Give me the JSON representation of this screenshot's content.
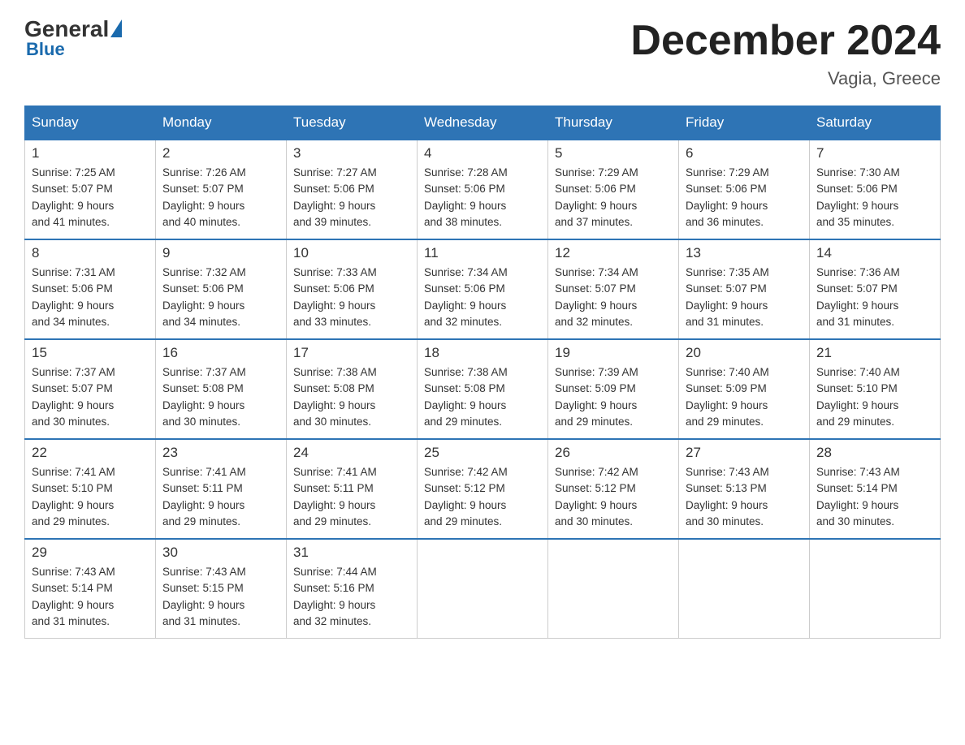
{
  "header": {
    "logo_general": "General",
    "logo_blue": "Blue",
    "month_title": "December 2024",
    "location": "Vagia, Greece"
  },
  "days_of_week": [
    "Sunday",
    "Monday",
    "Tuesday",
    "Wednesday",
    "Thursday",
    "Friday",
    "Saturday"
  ],
  "weeks": [
    [
      {
        "day": "1",
        "sunrise": "7:25 AM",
        "sunset": "5:07 PM",
        "daylight": "9 hours and 41 minutes."
      },
      {
        "day": "2",
        "sunrise": "7:26 AM",
        "sunset": "5:07 PM",
        "daylight": "9 hours and 40 minutes."
      },
      {
        "day": "3",
        "sunrise": "7:27 AM",
        "sunset": "5:06 PM",
        "daylight": "9 hours and 39 minutes."
      },
      {
        "day": "4",
        "sunrise": "7:28 AM",
        "sunset": "5:06 PM",
        "daylight": "9 hours and 38 minutes."
      },
      {
        "day": "5",
        "sunrise": "7:29 AM",
        "sunset": "5:06 PM",
        "daylight": "9 hours and 37 minutes."
      },
      {
        "day": "6",
        "sunrise": "7:29 AM",
        "sunset": "5:06 PM",
        "daylight": "9 hours and 36 minutes."
      },
      {
        "day": "7",
        "sunrise": "7:30 AM",
        "sunset": "5:06 PM",
        "daylight": "9 hours and 35 minutes."
      }
    ],
    [
      {
        "day": "8",
        "sunrise": "7:31 AM",
        "sunset": "5:06 PM",
        "daylight": "9 hours and 34 minutes."
      },
      {
        "day": "9",
        "sunrise": "7:32 AM",
        "sunset": "5:06 PM",
        "daylight": "9 hours and 34 minutes."
      },
      {
        "day": "10",
        "sunrise": "7:33 AM",
        "sunset": "5:06 PM",
        "daylight": "9 hours and 33 minutes."
      },
      {
        "day": "11",
        "sunrise": "7:34 AM",
        "sunset": "5:06 PM",
        "daylight": "9 hours and 32 minutes."
      },
      {
        "day": "12",
        "sunrise": "7:34 AM",
        "sunset": "5:07 PM",
        "daylight": "9 hours and 32 minutes."
      },
      {
        "day": "13",
        "sunrise": "7:35 AM",
        "sunset": "5:07 PM",
        "daylight": "9 hours and 31 minutes."
      },
      {
        "day": "14",
        "sunrise": "7:36 AM",
        "sunset": "5:07 PM",
        "daylight": "9 hours and 31 minutes."
      }
    ],
    [
      {
        "day": "15",
        "sunrise": "7:37 AM",
        "sunset": "5:07 PM",
        "daylight": "9 hours and 30 minutes."
      },
      {
        "day": "16",
        "sunrise": "7:37 AM",
        "sunset": "5:08 PM",
        "daylight": "9 hours and 30 minutes."
      },
      {
        "day": "17",
        "sunrise": "7:38 AM",
        "sunset": "5:08 PM",
        "daylight": "9 hours and 30 minutes."
      },
      {
        "day": "18",
        "sunrise": "7:38 AM",
        "sunset": "5:08 PM",
        "daylight": "9 hours and 29 minutes."
      },
      {
        "day": "19",
        "sunrise": "7:39 AM",
        "sunset": "5:09 PM",
        "daylight": "9 hours and 29 minutes."
      },
      {
        "day": "20",
        "sunrise": "7:40 AM",
        "sunset": "5:09 PM",
        "daylight": "9 hours and 29 minutes."
      },
      {
        "day": "21",
        "sunrise": "7:40 AM",
        "sunset": "5:10 PM",
        "daylight": "9 hours and 29 minutes."
      }
    ],
    [
      {
        "day": "22",
        "sunrise": "7:41 AM",
        "sunset": "5:10 PM",
        "daylight": "9 hours and 29 minutes."
      },
      {
        "day": "23",
        "sunrise": "7:41 AM",
        "sunset": "5:11 PM",
        "daylight": "9 hours and 29 minutes."
      },
      {
        "day": "24",
        "sunrise": "7:41 AM",
        "sunset": "5:11 PM",
        "daylight": "9 hours and 29 minutes."
      },
      {
        "day": "25",
        "sunrise": "7:42 AM",
        "sunset": "5:12 PM",
        "daylight": "9 hours and 29 minutes."
      },
      {
        "day": "26",
        "sunrise": "7:42 AM",
        "sunset": "5:12 PM",
        "daylight": "9 hours and 30 minutes."
      },
      {
        "day": "27",
        "sunrise": "7:43 AM",
        "sunset": "5:13 PM",
        "daylight": "9 hours and 30 minutes."
      },
      {
        "day": "28",
        "sunrise": "7:43 AM",
        "sunset": "5:14 PM",
        "daylight": "9 hours and 30 minutes."
      }
    ],
    [
      {
        "day": "29",
        "sunrise": "7:43 AM",
        "sunset": "5:14 PM",
        "daylight": "9 hours and 31 minutes."
      },
      {
        "day": "30",
        "sunrise": "7:43 AM",
        "sunset": "5:15 PM",
        "daylight": "9 hours and 31 minutes."
      },
      {
        "day": "31",
        "sunrise": "7:44 AM",
        "sunset": "5:16 PM",
        "daylight": "9 hours and 32 minutes."
      },
      {
        "day": "",
        "sunrise": "",
        "sunset": "",
        "daylight": ""
      },
      {
        "day": "",
        "sunrise": "",
        "sunset": "",
        "daylight": ""
      },
      {
        "day": "",
        "sunrise": "",
        "sunset": "",
        "daylight": ""
      },
      {
        "day": "",
        "sunrise": "",
        "sunset": "",
        "daylight": ""
      }
    ]
  ],
  "labels": {
    "sunrise_prefix": "Sunrise: ",
    "sunset_prefix": "Sunset: ",
    "daylight_prefix": "Daylight: "
  }
}
